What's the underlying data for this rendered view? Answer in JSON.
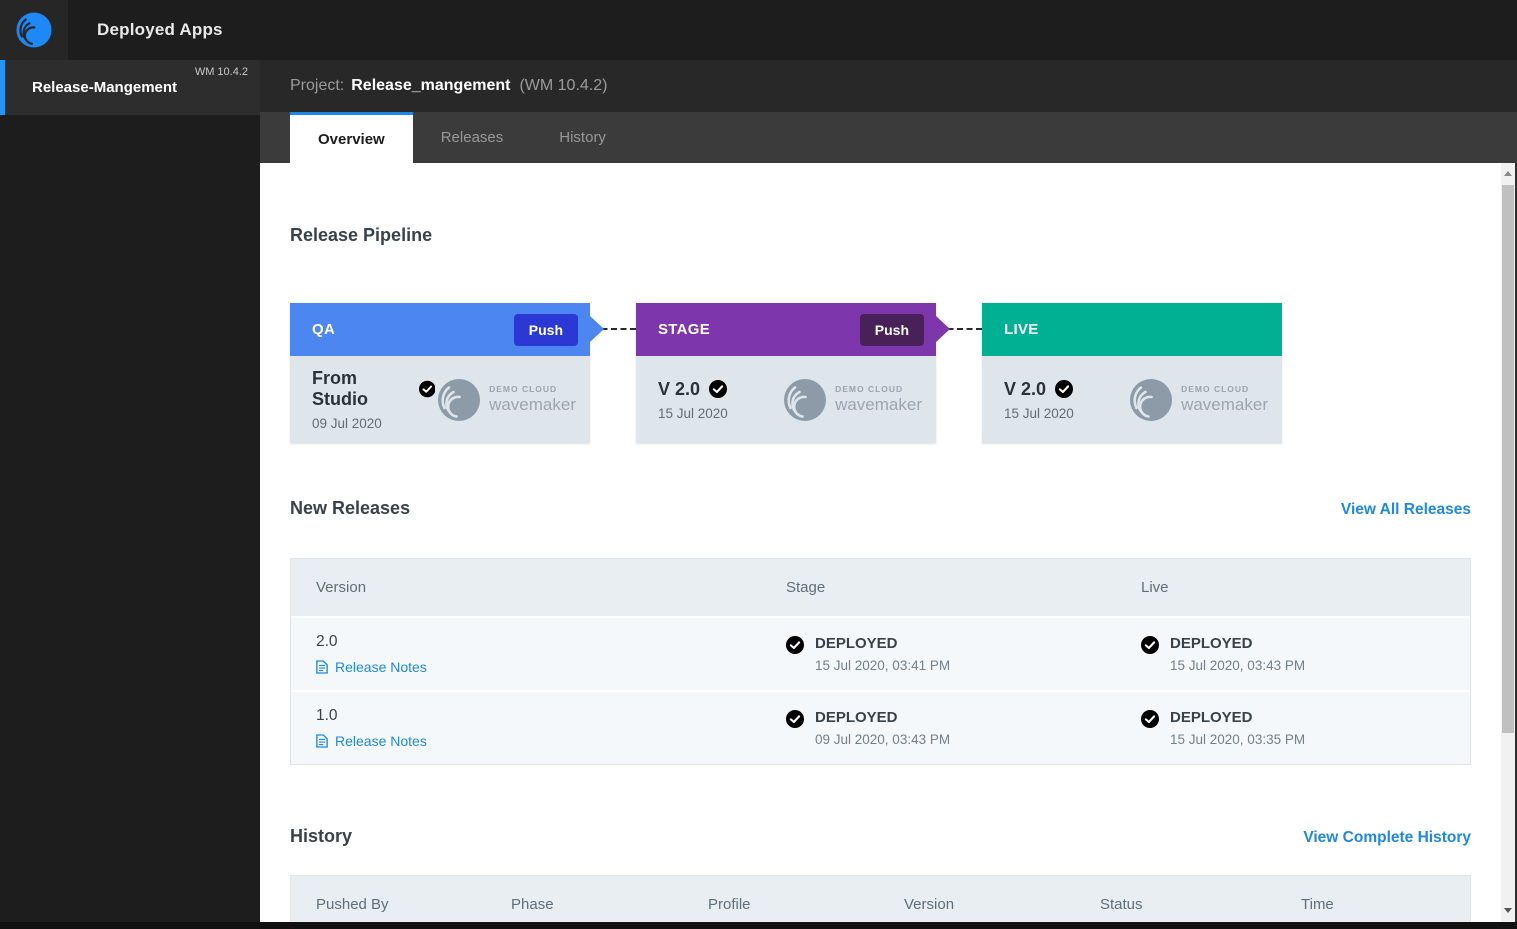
{
  "topbar": {
    "title": "Deployed Apps"
  },
  "sidebar": {
    "app": {
      "name": "Release-Mangement",
      "version": "WM 10.4.2"
    }
  },
  "project_header": {
    "label": "Project:",
    "name": "Release_mangement",
    "version": "(WM 10.4.2)"
  },
  "tabs": [
    {
      "label": "Overview",
      "active": true
    },
    {
      "label": "Releases",
      "active": false
    },
    {
      "label": "History",
      "active": false
    }
  ],
  "pipeline": {
    "heading": "Release Pipeline",
    "stages": [
      {
        "name": "QA",
        "push_label": "Push",
        "version": "From Studio",
        "date": "09 Jul 2020",
        "header_color": "#4c86f1",
        "push_color": "#2c38d4",
        "check": "green"
      },
      {
        "name": "STAGE",
        "push_label": "Push",
        "version": "V 2.0",
        "date": "15 Jul 2020",
        "header_color": "#7d36ab",
        "push_color": "#482158",
        "check": "green"
      },
      {
        "name": "LIVE",
        "version": "V 2.0",
        "date": "15 Jul 2020",
        "header_color": "#00b093",
        "check": "green"
      }
    ],
    "cloud_logo": {
      "line1": "DEMO CLOUD",
      "line2": "wavemaker"
    }
  },
  "new_releases": {
    "heading": "New Releases",
    "view_all_label": "View All Releases",
    "columns": [
      "Version",
      "Stage",
      "Live"
    ],
    "release_notes_label": "Release Notes",
    "rows": [
      {
        "version": "2.0",
        "stage": {
          "status": "DEPLOYED",
          "time": "15 Jul 2020, 03:41 PM",
          "check": "green"
        },
        "live": {
          "status": "DEPLOYED",
          "time": "15 Jul 2020, 03:43 PM",
          "check": "green"
        }
      },
      {
        "version": "1.0",
        "stage": {
          "status": "DEPLOYED",
          "time": "09 Jul 2020, 03:43 PM",
          "check": "muted"
        },
        "live": {
          "status": "DEPLOYED",
          "time": "15 Jul 2020, 03:35 PM",
          "check": "muted"
        }
      }
    ]
  },
  "history": {
    "heading": "History",
    "view_all_label": "View Complete History",
    "columns": [
      "Pushed By",
      "Phase",
      "Profile",
      "Version",
      "Status",
      "Time"
    ]
  },
  "colors": {
    "accent_blue": "#1e88e5",
    "green_check": "#23ad4b",
    "muted_check": "#9d8b8b",
    "qa_header": "#4c86f1",
    "stage_header": "#7d36ab",
    "live_header": "#00b093"
  }
}
